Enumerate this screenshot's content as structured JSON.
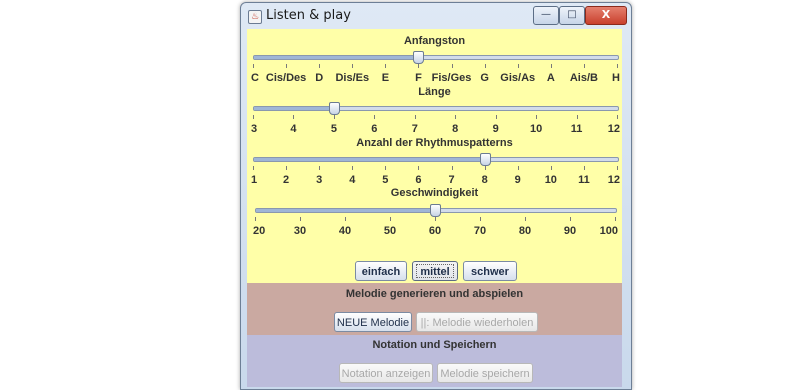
{
  "window": {
    "title": "Listen & play",
    "controls": {
      "minimize": "—",
      "maximize": "□",
      "close": "X"
    }
  },
  "sliders": [
    {
      "id": "anfangston",
      "title": "Anfangston",
      "labels": [
        "C",
        "Cis/Des",
        "D",
        "Dis/Es",
        "E",
        "F",
        "Fis/Ges",
        "G",
        "Gis/As",
        "A",
        "Ais/B",
        "H"
      ],
      "value_index": 5,
      "value_label": "F"
    },
    {
      "id": "laenge",
      "title": "Länge",
      "labels": [
        "3",
        "4",
        "5",
        "6",
        "7",
        "8",
        "9",
        "10",
        "11",
        "12"
      ],
      "value": 5
    },
    {
      "id": "rhythmus",
      "title": "Anzahl der Rhythmuspatterns",
      "labels": [
        "1",
        "2",
        "3",
        "4",
        "5",
        "6",
        "7",
        "8",
        "9",
        "10",
        "11",
        "12"
      ],
      "value": 8
    },
    {
      "id": "geschwindigkeit",
      "title": "Geschwindigkeit",
      "labels": [
        "20",
        "30",
        "40",
        "50",
        "60",
        "70",
        "80",
        "90",
        "100"
      ],
      "value": 60
    }
  ],
  "difficulty": {
    "buttons": [
      "einfach",
      "mittel",
      "schwer"
    ],
    "selected": "mittel"
  },
  "melody_section": {
    "title": "Melodie generieren und abspielen",
    "new_button": "NEUE Melodie",
    "repeat_button": "||: Melodie wiederholen :||"
  },
  "notation_section": {
    "title": "Notation und Speichern",
    "show_button": "Notation anzeigen",
    "save_button": "Melodie speichern"
  },
  "colors": {
    "yellow_panel": "#ffffa8",
    "pink_panel": "#caa9a1",
    "purple_panel": "#bcbcdb"
  }
}
